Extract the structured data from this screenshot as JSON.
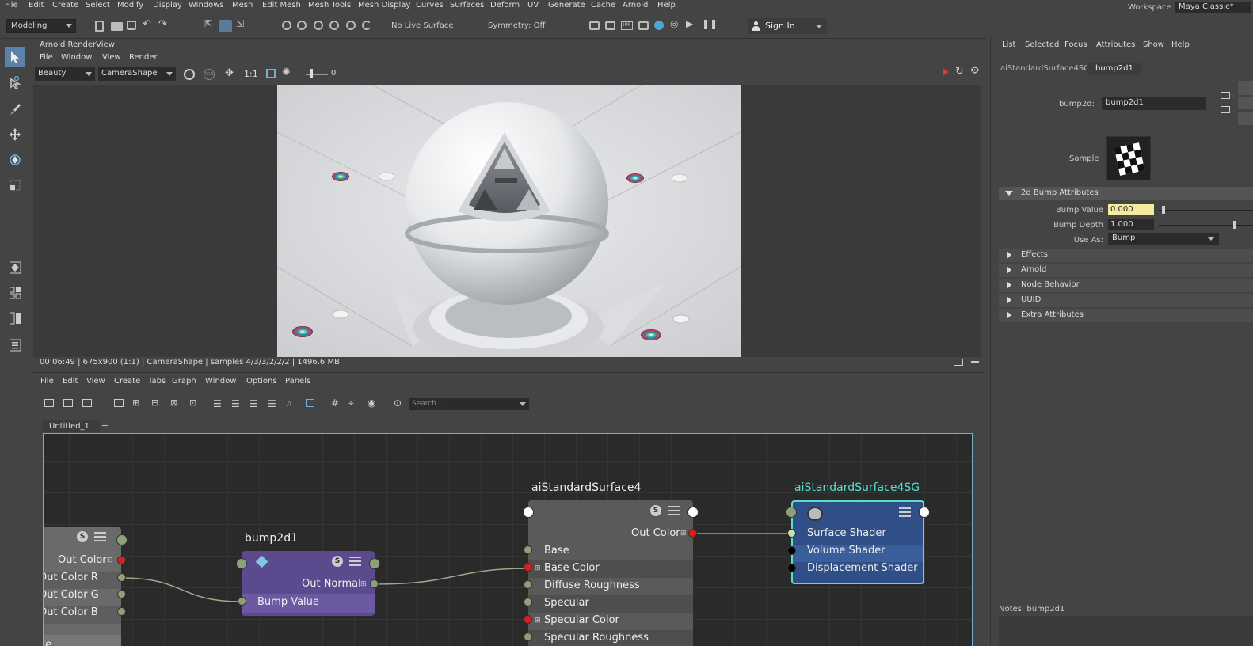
{
  "menubar": {
    "items": [
      "File",
      "Edit",
      "Create",
      "Select",
      "Modify",
      "Display",
      "Windows",
      "Mesh",
      "Edit Mesh",
      "Mesh Tools",
      "Mesh Display",
      "Curves",
      "Surfaces",
      "Deform",
      "UV",
      "Generate",
      "Cache",
      "Arnold",
      "Help"
    ],
    "workspace_label": "Workspace :",
    "workspace_value": "Maya Classic*"
  },
  "statusline": {
    "mode": "Modeling",
    "live_surface": "No Live Surface",
    "symmetry": "Symmetry: Off",
    "sign_in": "Sign In"
  },
  "renderview": {
    "title": "Arnold RenderView",
    "menu": [
      "File",
      "Window",
      "View",
      "Render"
    ],
    "aov": "Beauty",
    "camera": "CameraShape",
    "ratio": "1:1",
    "exposure_value": "0",
    "status": "00:06:49 | 675x900 (1:1) | CameraShape  | samples 4/3/3/2/2/2 | 1496.6 MB",
    "accent_play": "#e03a2a"
  },
  "node_editor": {
    "menu": [
      "File",
      "Edit",
      "View",
      "Create",
      "Tabs",
      "Graph",
      "Window",
      "Options",
      "Panels"
    ],
    "search_placeholder": "Search...",
    "tab": "Untitled_1",
    "tab_add": "+",
    "nodes": {
      "left": {
        "ports": [
          "Out Color",
          "Out Color R",
          "Out Color G",
          "Out Color B",
          "de"
        ]
      },
      "bump": {
        "title": "bump2d1",
        "out": "Out Normal",
        "in": "Bump Value",
        "color": "#5b4a8e"
      },
      "surface": {
        "title": "aiStandardSurface4",
        "out": "Out Color",
        "inputs": [
          "Base",
          "Base Color",
          "Diffuse Roughness",
          "Specular",
          "Specular Color",
          "Specular Roughness"
        ]
      },
      "sg": {
        "title": "aiStandardSurface4SG",
        "inputs": [
          "Surface Shader",
          "Volume Shader",
          "Displacement Shader"
        ],
        "color": "#2f4f86",
        "border": "#56e0c8"
      }
    }
  },
  "attribute_editor": {
    "menu": [
      "List",
      "Selected",
      "Focus",
      "Attributes",
      "Show",
      "Help"
    ],
    "tabs": [
      "aiStandardSurface4SG",
      "bump2d1"
    ],
    "node_label": "bump2d:",
    "node_name": "bump2d1",
    "sample_label": "Sample",
    "sections": {
      "bump": "2d Bump Attributes",
      "effects": "Effects",
      "arnold": "Arnold",
      "node_behavior": "Node Behavior",
      "uuid": "UUID",
      "extra": "Extra Attributes"
    },
    "bump_value_label": "Bump Value",
    "bump_value": "0.000",
    "bump_depth_label": "Bump Depth",
    "bump_depth": "1.000",
    "use_as_label": "Use As:",
    "use_as": "Bump",
    "notes": "Notes:  bump2d1"
  }
}
